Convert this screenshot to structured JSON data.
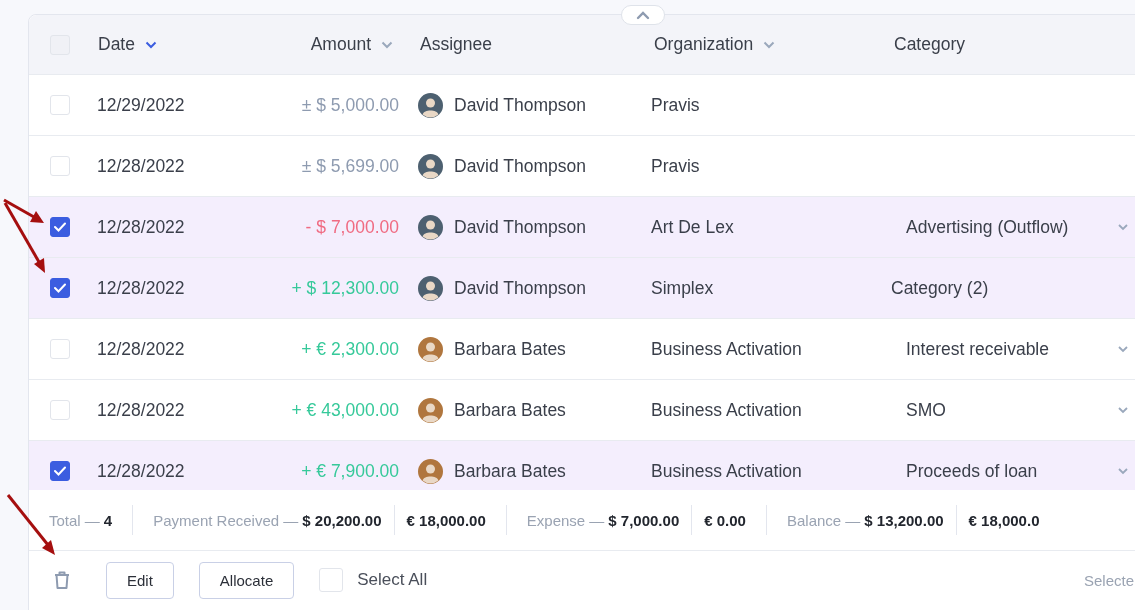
{
  "table": {
    "columns": [
      {
        "label": "Date",
        "kind": "sorted"
      },
      {
        "label": "Amount",
        "kind": "sortable"
      },
      {
        "label": "Assignee",
        "kind": "plain"
      },
      {
        "label": "Organization",
        "kind": "sortable"
      },
      {
        "label": "Category",
        "kind": "plain"
      }
    ],
    "header_checkbox": {
      "checked": false
    },
    "rows": [
      {
        "selected": false,
        "date": "12/29/2022",
        "amount": {
          "kind": "neutral",
          "text": "± $ 5,000.00"
        },
        "assignee": {
          "name": "David Thompson",
          "color": "#4d6070"
        },
        "organization": "Pravis",
        "category": {
          "kind": "none"
        }
      },
      {
        "selected": false,
        "date": "12/28/2022",
        "amount": {
          "kind": "neutral",
          "text": "± $ 5,699.00"
        },
        "assignee": {
          "name": "David Thompson",
          "color": "#4d6070"
        },
        "organization": "Pravis",
        "category": {
          "kind": "none"
        }
      },
      {
        "selected": true,
        "date": "12/28/2022",
        "amount": {
          "kind": "negative",
          "text": "- $ 7,000.00"
        },
        "assignee": {
          "name": "David Thompson",
          "color": "#4d6070"
        },
        "organization": "Art De Lex",
        "category": {
          "kind": "dropdown",
          "text": "Advertising (Outflow)"
        }
      },
      {
        "selected": true,
        "date": "12/28/2022",
        "amount": {
          "kind": "positive",
          "text": "+ $ 12,300.00"
        },
        "assignee": {
          "name": "David Thompson",
          "color": "#4d6070"
        },
        "organization": "Simplex",
        "category": {
          "kind": "multiple",
          "text": "Category (2)"
        }
      },
      {
        "selected": false,
        "date": "12/28/2022",
        "amount": {
          "kind": "positive",
          "text": "+ € 2,300.00"
        },
        "assignee": {
          "name": "Barbara Bates",
          "color": "#b0763e"
        },
        "organization": "Business Activation",
        "category": {
          "kind": "dropdown",
          "text": "Interest receivable"
        }
      },
      {
        "selected": false,
        "date": "12/28/2022",
        "amount": {
          "kind": "positive",
          "text": "+ € 43,000.00"
        },
        "assignee": {
          "name": "Barbara Bates",
          "color": "#b0763e"
        },
        "organization": "Business Activation",
        "category": {
          "kind": "dropdown",
          "text": "SMO"
        }
      },
      {
        "selected": true,
        "date": "12/28/2022",
        "amount": {
          "kind": "positive",
          "text": "+ € 7,900.00"
        },
        "assignee": {
          "name": "Barbara Bates",
          "color": "#b0763e"
        },
        "organization": "Business Activation",
        "category": {
          "kind": "dropdown",
          "text": "Proceeds of loan"
        }
      }
    ]
  },
  "summary": [
    {
      "label": "Total —",
      "values": [
        "4"
      ]
    },
    {
      "label": "Payment Received —",
      "values": [
        "$ 20,200.00",
        "€ 18,000.00"
      ]
    },
    {
      "label": "Expense —",
      "values": [
        "$ 7,000.00",
        "€ 0.00"
      ]
    },
    {
      "label": "Balance —",
      "values": [
        "$ 13,200.00",
        "€ 18,000.0"
      ]
    }
  ],
  "actions": {
    "buttons": [
      "Edit",
      "Allocate"
    ],
    "select_all": {
      "label": "Select All",
      "checked": false
    },
    "selected_text": "Selecte"
  }
}
